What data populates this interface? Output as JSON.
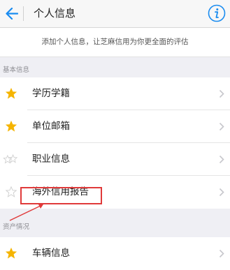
{
  "header": {
    "title": "个人信息",
    "back_icon": "back-arrow-icon",
    "info_icon": "info-icon"
  },
  "intro": {
    "text": "添加个人信息，让芝麻信用为你更全面的评估"
  },
  "sections": [
    {
      "label": "基本信息",
      "items": [
        {
          "label": "学历学籍",
          "star": "filled"
        },
        {
          "label": "单位邮箱",
          "star": "filled"
        },
        {
          "label": "职业信息",
          "star": "partial"
        },
        {
          "label": "海外信用报告",
          "star": "empty"
        }
      ]
    },
    {
      "label": "资产情况",
      "items": [
        {
          "label": "车辆信息",
          "star": "filled"
        }
      ]
    }
  ],
  "colors": {
    "accent": "#1a8cf0",
    "star_gold": "#f5b400",
    "star_gray": "#cccccc",
    "annotation_red": "#e03a3a"
  }
}
